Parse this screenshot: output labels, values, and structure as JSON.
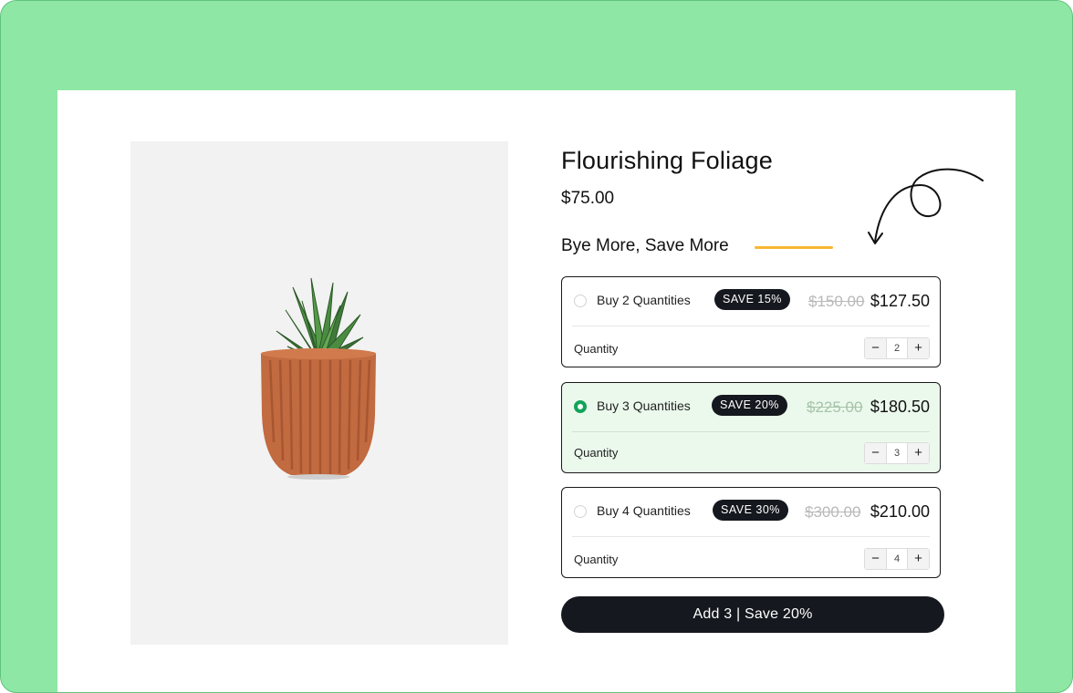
{
  "product": {
    "title": "Flourishing Foliage",
    "price": "$75.00",
    "image_icon": "potted-succulent-image"
  },
  "bundle": {
    "heading": "Bye More, Save More",
    "accent_color": "#f7b733",
    "selected_color": "#13a35b",
    "offers": [
      {
        "label": "Buy 2 Quantities",
        "badge": "SAVE 15%",
        "old_price": "$150.00",
        "new_price": "$127.50",
        "quantity_label": "Quantity",
        "quantity": "2",
        "selected": false
      },
      {
        "label": "Buy 3 Quantities",
        "badge": "SAVE 20%",
        "old_price": "$225.00",
        "new_price": "$180.50",
        "quantity_label": "Quantity",
        "quantity": "3",
        "selected": true
      },
      {
        "label": "Buy 4 Quantities",
        "badge": "SAVE 30%",
        "old_price": "$300.00",
        "new_price": "$210.00",
        "quantity_label": "Quantity",
        "quantity": "4",
        "selected": false
      }
    ],
    "stepper": {
      "minus": "−",
      "plus": "+"
    }
  },
  "cta": {
    "label": "Add 3 | Save 20%"
  },
  "colors": {
    "frame": "#8fe7a5",
    "dark": "#15181e",
    "selected_bg": "#ebf9ec"
  }
}
